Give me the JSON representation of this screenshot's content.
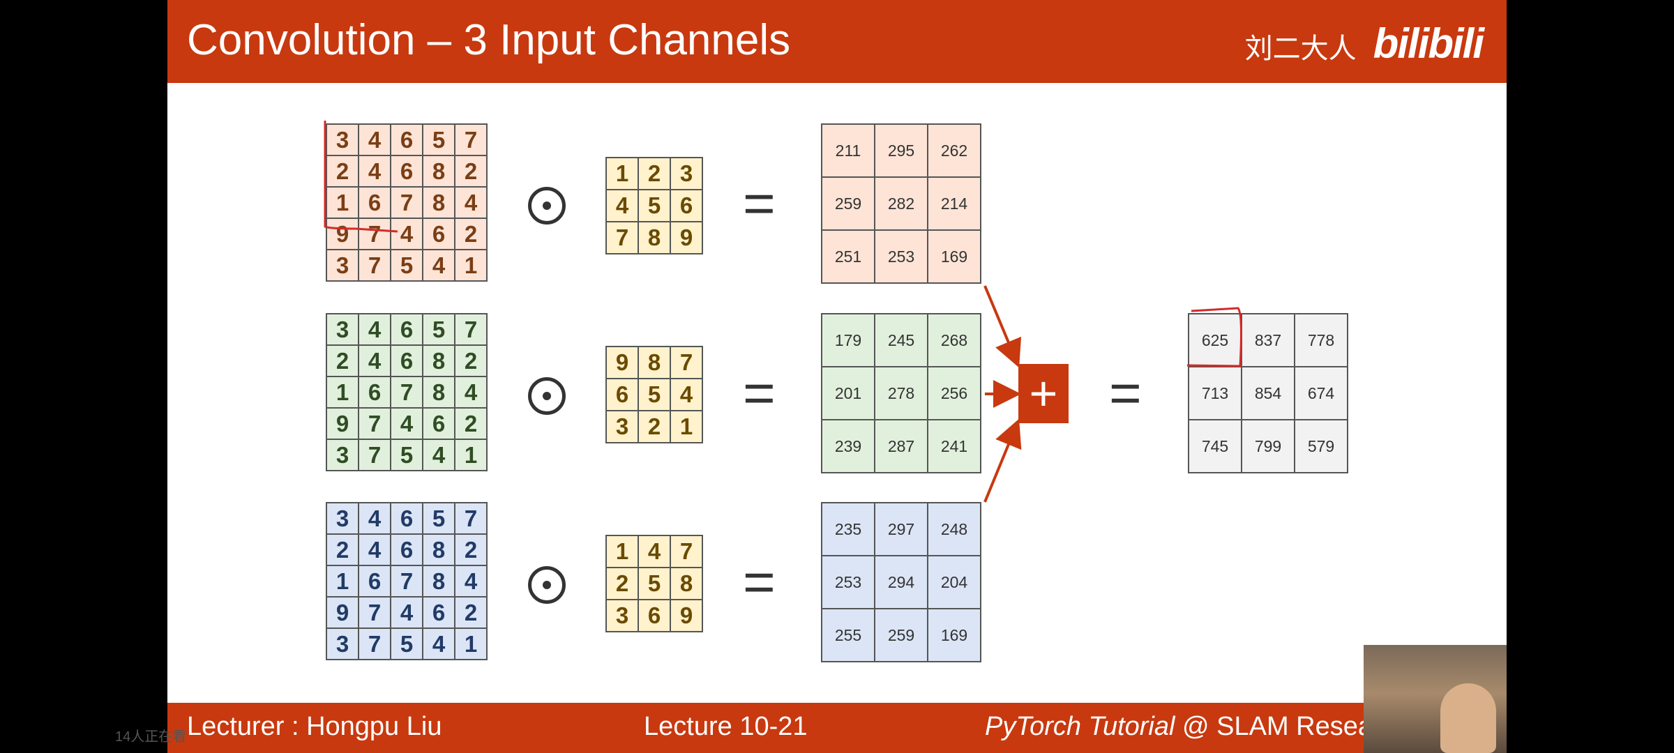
{
  "slide": {
    "title": "Convolution – 3 Input Channels",
    "brand_cn": "刘二大人",
    "brand_logo": "bilibili"
  },
  "footer": {
    "lecturer": "Lecturer : Hongpu Liu",
    "lecture": "Lecture 10-21",
    "tutorial_italic": "PyTorch Tutorial",
    "tutorial_rest": " @ SLAM Resea"
  },
  "channels": [
    {
      "input": [
        [
          3,
          4,
          6,
          5,
          7
        ],
        [
          2,
          4,
          6,
          8,
          2
        ],
        [
          1,
          6,
          7,
          8,
          4
        ],
        [
          9,
          7,
          4,
          6,
          2
        ],
        [
          3,
          7,
          5,
          4,
          1
        ]
      ],
      "kernel": [
        [
          1,
          2,
          3
        ],
        [
          4,
          5,
          6
        ],
        [
          7,
          8,
          9
        ]
      ],
      "output": [
        [
          211,
          295,
          262
        ],
        [
          259,
          282,
          214
        ],
        [
          251,
          253,
          169
        ]
      ]
    },
    {
      "input": [
        [
          3,
          4,
          6,
          5,
          7
        ],
        [
          2,
          4,
          6,
          8,
          2
        ],
        [
          1,
          6,
          7,
          8,
          4
        ],
        [
          9,
          7,
          4,
          6,
          2
        ],
        [
          3,
          7,
          5,
          4,
          1
        ]
      ],
      "kernel": [
        [
          9,
          8,
          7
        ],
        [
          6,
          5,
          4
        ],
        [
          3,
          2,
          1
        ]
      ],
      "output": [
        [
          179,
          245,
          268
        ],
        [
          201,
          278,
          256
        ],
        [
          239,
          287,
          241
        ]
      ]
    },
    {
      "input": [
        [
          3,
          4,
          6,
          5,
          7
        ],
        [
          2,
          4,
          6,
          8,
          2
        ],
        [
          1,
          6,
          7,
          8,
          4
        ],
        [
          9,
          7,
          4,
          6,
          2
        ],
        [
          3,
          7,
          5,
          4,
          1
        ]
      ],
      "kernel": [
        [
          1,
          4,
          7
        ],
        [
          2,
          5,
          8
        ],
        [
          3,
          6,
          9
        ]
      ],
      "output": [
        [
          235,
          297,
          248
        ],
        [
          253,
          294,
          204
        ],
        [
          255,
          259,
          169
        ]
      ]
    }
  ],
  "operators": {
    "plus": "+",
    "equals": "="
  },
  "result": [
    [
      625,
      837,
      778
    ],
    [
      713,
      854,
      674
    ],
    [
      745,
      799,
      579
    ]
  ],
  "viewer_count": "14人正在看",
  "colors": {
    "accent": "#c8390f",
    "channel_red": "#fde4d7",
    "channel_green": "#e1f0dc",
    "channel_blue": "#dbe5f6",
    "kernel": "#fff2cc",
    "result": "#f2f2f2",
    "annotation": "#d12b2b"
  }
}
